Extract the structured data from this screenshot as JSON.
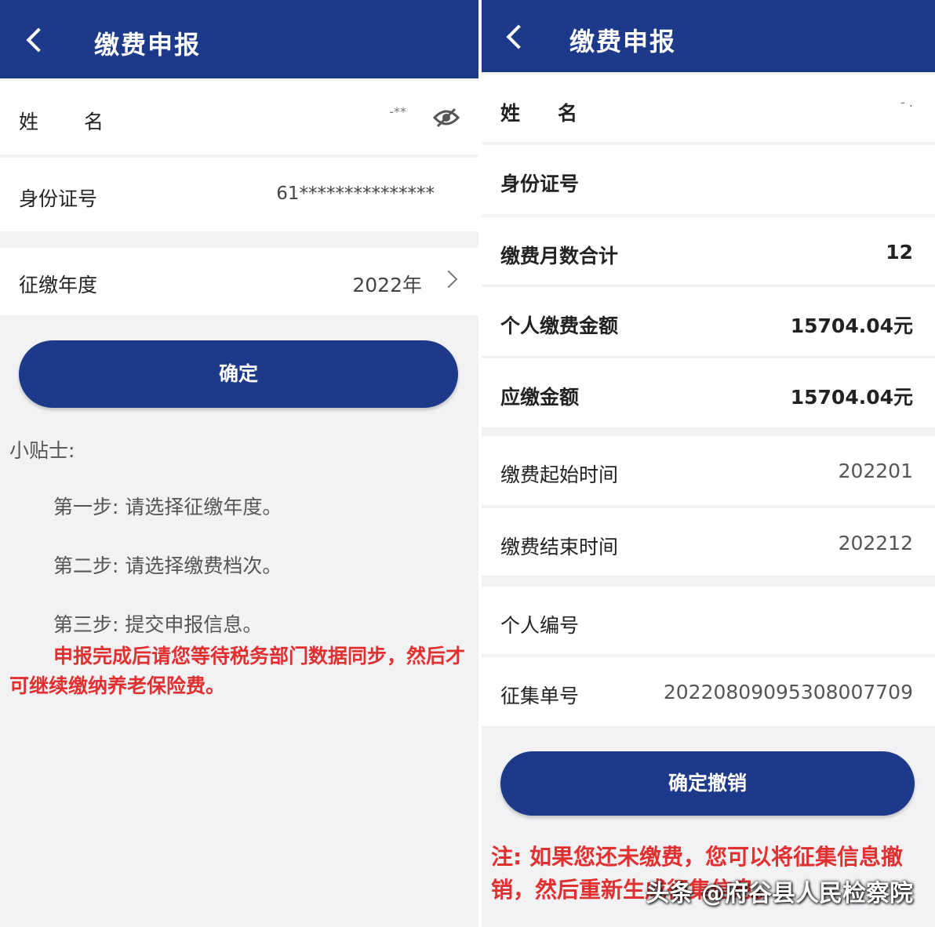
{
  "left": {
    "header": {
      "title": "缴费申报",
      "back_icon": "chevron-left-icon"
    },
    "rows": {
      "name": {
        "label": "姓名",
        "value": "-**"
      },
      "id": {
        "label": "身份证号",
        "value": "61***************"
      },
      "year": {
        "label": "征缴年度",
        "value": "2022年"
      }
    },
    "confirm_label": "确定",
    "tips": {
      "heading": "小贴士:",
      "step1": "第一步: 请选择征缴年度。",
      "step2": "第二步: 请选择缴费档次。",
      "step3": "第三步: 提交申报信息。",
      "warning": "申报完成后请您等待税务部门数据同步，然后才可继续缴纳养老保险费。"
    }
  },
  "right": {
    "header": {
      "title": "缴费申报",
      "back_icon": "chevron-left-icon"
    },
    "rows": {
      "name": {
        "label": "姓名",
        "value": "- ."
      },
      "id": {
        "label": "身份证号",
        "value": ""
      },
      "months": {
        "label": "缴费月数合计",
        "value": "12"
      },
      "personal": {
        "label": "个人缴费金额",
        "value": "15704.04元"
      },
      "due": {
        "label": "应缴金额",
        "value": "15704.04元"
      },
      "start": {
        "label": "缴费起始时间",
        "value": "202201"
      },
      "end": {
        "label": "缴费结束时间",
        "value": "202212"
      },
      "pid": {
        "label": "个人编号",
        "value": ""
      },
      "collect": {
        "label": "征集单号",
        "value": "20220809095308007709"
      }
    },
    "cancel_label": "确定撤销",
    "note": "注: 如果您还未缴费，您可以将征集信息撤销，然后重新生成征集信息。",
    "watermark": "头条 @府谷县人民检察院"
  },
  "colors": {
    "primary": "#1d3a8a",
    "warning": "#e03030",
    "background": "#f2f2f5"
  }
}
